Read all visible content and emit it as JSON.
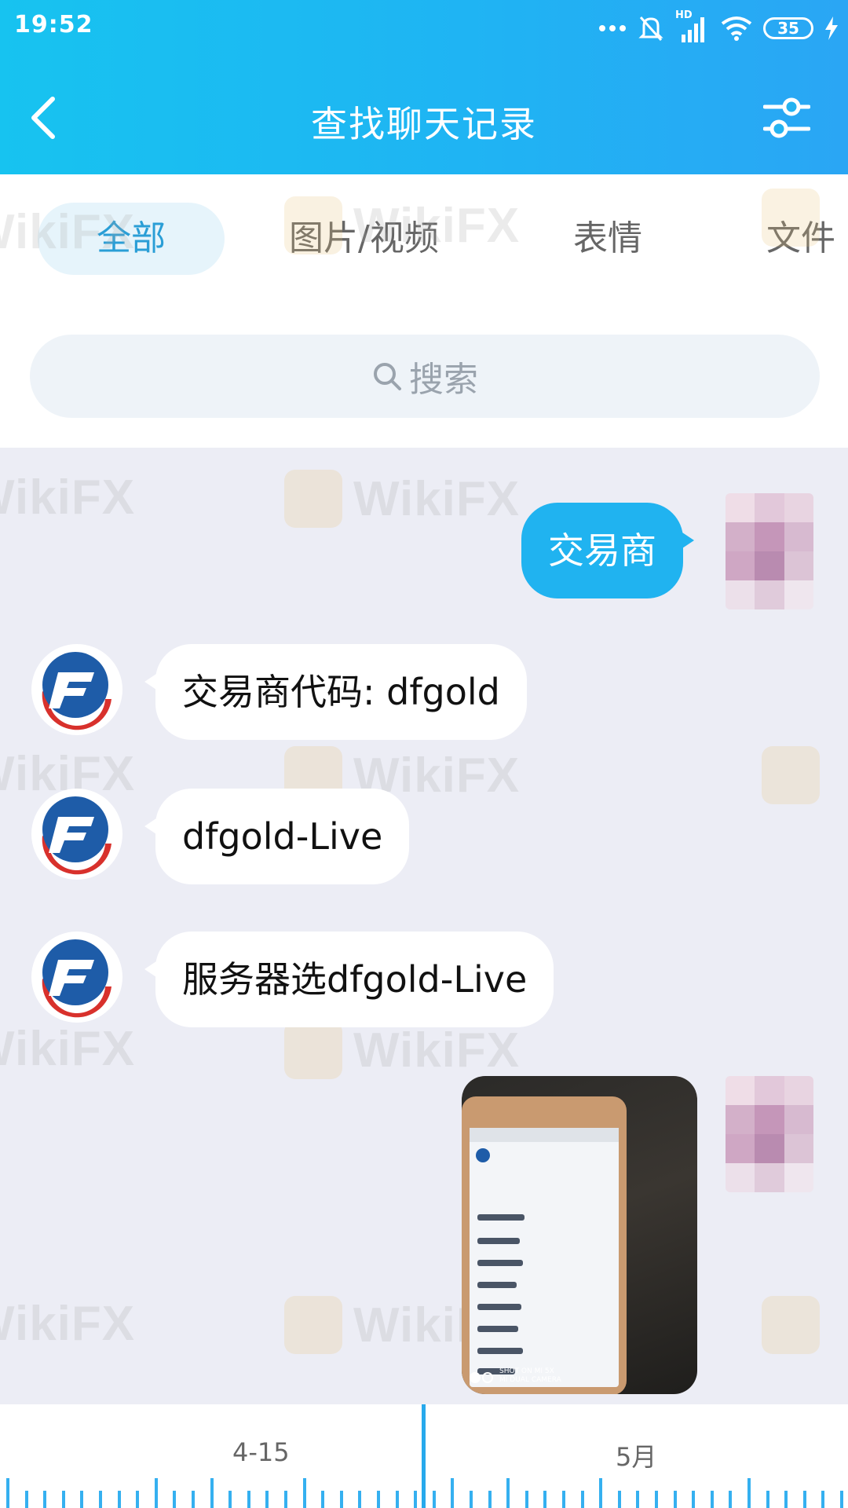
{
  "status_bar": {
    "time": "19:52",
    "network_label": "HD",
    "battery_level": "35"
  },
  "nav": {
    "title": "查找聊天记录"
  },
  "tabs": [
    {
      "label": "全部",
      "active": true
    },
    {
      "label": "图片/视频",
      "active": false
    },
    {
      "label": "表情",
      "active": false
    },
    {
      "label": "文件",
      "active": false
    }
  ],
  "search": {
    "placeholder": "搜索"
  },
  "messages": [
    {
      "direction": "out",
      "type": "text",
      "text": "交易商"
    },
    {
      "direction": "in",
      "type": "text",
      "text": "交易商代码: dfgold"
    },
    {
      "direction": "in",
      "type": "text",
      "text": "dfgold-Live"
    },
    {
      "direction": "in",
      "type": "text",
      "text": "服务器选dfgold-Live"
    },
    {
      "direction": "out",
      "type": "image",
      "caption_line1": "SHOT ON MI 5X",
      "caption_line2": "MI DUAL CAMERA"
    }
  ],
  "watermark": {
    "text": "WikiFX"
  },
  "timeline": {
    "labels": [
      "4-15",
      "5月"
    ]
  },
  "colors": {
    "header_start": "#17c3f0",
    "header_end": "#2aa6f4",
    "outgoing_bubble": "#20b3f0",
    "active_tab_text": "#2a9ed6",
    "timeline_indicator": "#27a9ec",
    "chat_background": "#ecedf5"
  }
}
